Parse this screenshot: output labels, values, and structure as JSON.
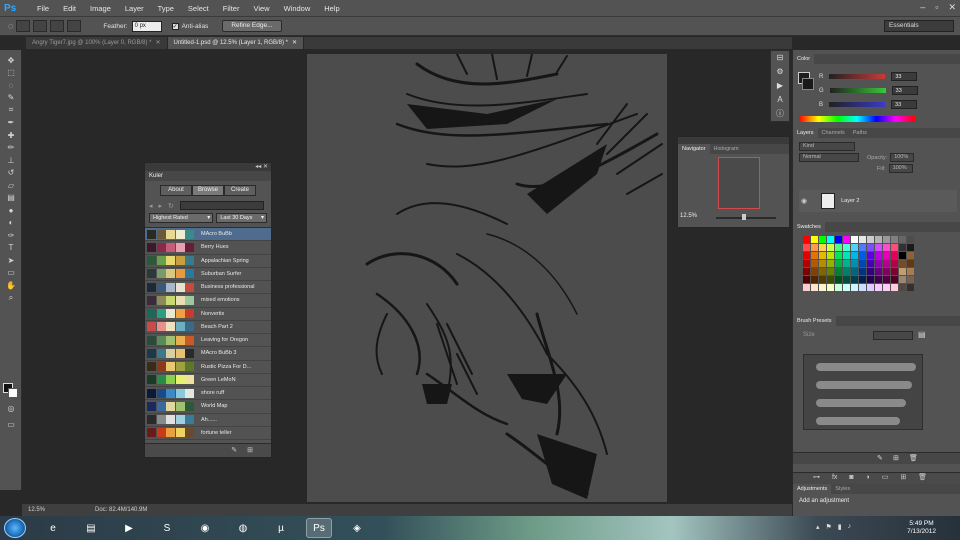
{
  "app": {
    "logo": "Ps"
  },
  "menu": [
    "File",
    "Edit",
    "Image",
    "Layer",
    "Type",
    "Select",
    "Filter",
    "View",
    "Window",
    "Help"
  ],
  "window_controls": [
    "–",
    "▫",
    "✕"
  ],
  "options": {
    "feather_label": "Feather:",
    "feather_value": "0 px",
    "antialias_label": "Anti-alias",
    "antialias_checked": true,
    "refine_edge": "Refine Edge...",
    "workspace": "Essentials"
  },
  "tabs": [
    {
      "label": "Angry Tiger7.jpg @ 100% (Layer 0, RGB/8) *",
      "active": false
    },
    {
      "label": "Untitled-1.psd @ 12.5% (Layer 1, RGB/8) *",
      "active": true
    }
  ],
  "tools": [
    {
      "name": "move-tool-icon",
      "glyph": "✥"
    },
    {
      "name": "marquee-tool-icon",
      "glyph": "⬚"
    },
    {
      "name": "lasso-tool-icon",
      "glyph": "◌"
    },
    {
      "name": "quick-select-icon",
      "glyph": "✎"
    },
    {
      "name": "crop-tool-icon",
      "glyph": "⌗"
    },
    {
      "name": "eyedropper-icon",
      "glyph": "✒"
    },
    {
      "name": "healing-brush-icon",
      "glyph": "✚"
    },
    {
      "name": "brush-tool-icon",
      "glyph": "✏"
    },
    {
      "name": "clone-stamp-icon",
      "glyph": "⊥"
    },
    {
      "name": "history-brush-icon",
      "glyph": "↺"
    },
    {
      "name": "eraser-icon",
      "glyph": "▱"
    },
    {
      "name": "gradient-tool-icon",
      "glyph": "▤"
    },
    {
      "name": "blur-tool-icon",
      "glyph": "●"
    },
    {
      "name": "dodge-tool-icon",
      "glyph": "◐"
    },
    {
      "name": "pen-tool-icon",
      "glyph": "✑"
    },
    {
      "name": "type-tool-icon",
      "glyph": "T"
    },
    {
      "name": "path-select-icon",
      "glyph": "➤"
    },
    {
      "name": "shape-tool-icon",
      "glyph": "▭"
    },
    {
      "name": "hand-tool-icon",
      "glyph": "✋"
    },
    {
      "name": "zoom-tool-icon",
      "glyph": "⌕"
    }
  ],
  "status": {
    "zoom": "12.5%",
    "doc": "Doc: 82.4M/140.9M"
  },
  "kuler": {
    "title": "Kuler",
    "collapse": "◂◂ ✕",
    "buttons": [
      "About",
      "Browse",
      "Create"
    ],
    "filters": [
      "Highest Rated",
      "Last 30 Days"
    ],
    "themes": [
      {
        "name": "MAcro BuBb",
        "colors": [
          "#2a2a22",
          "#6b5a3a",
          "#e8d890",
          "#f0ecd0",
          "#3a8c8c"
        ],
        "selected": true
      },
      {
        "name": "Berry Hues",
        "colors": [
          "#3a1a2a",
          "#8a2a4a",
          "#c85a7a",
          "#e8a0b0",
          "#6a1a3a"
        ]
      },
      {
        "name": "Appalachian Spring",
        "colors": [
          "#2a5a3a",
          "#6aa04a",
          "#e8d870",
          "#c8a040",
          "#3a7a8a"
        ]
      },
      {
        "name": "Suburban Surfer",
        "colors": [
          "#2a3a3a",
          "#7a9a6a",
          "#d8c880",
          "#e89a40",
          "#2a7aa0"
        ]
      },
      {
        "name": "Business professional",
        "colors": [
          "#1a2a3a",
          "#3a5a7a",
          "#a8b8c8",
          "#e8e0d0",
          "#c84a3a"
        ]
      },
      {
        "name": "mixed emotions",
        "colors": [
          "#3a2a3a",
          "#8a8a5a",
          "#c8d870",
          "#e8e0b0",
          "#a0c8a0"
        ]
      },
      {
        "name": "Nonvertis",
        "colors": [
          "#1a6a5a",
          "#2aa080",
          "#e8e8d0",
          "#f0a040",
          "#c83a2a"
        ]
      },
      {
        "name": "Beach Part 2",
        "colors": [
          "#c84a4a",
          "#e89090",
          "#f0e0c0",
          "#6ab0c0",
          "#3a6a8a"
        ]
      },
      {
        "name": "Leaving for Oregon",
        "colors": [
          "#2a4a3a",
          "#5a8a5a",
          "#a0c070",
          "#e8b050",
          "#c85a2a"
        ]
      },
      {
        "name": "MAcro BuBb 3",
        "colors": [
          "#1a3a4a",
          "#3a7a8a",
          "#d8d0a0",
          "#e8c070",
          "#2a2a2a"
        ]
      },
      {
        "name": "Rustic Pizza For D...",
        "colors": [
          "#3a2a1a",
          "#8a3a1a",
          "#e8c870",
          "#a0a040",
          "#5a7a2a"
        ]
      },
      {
        "name": "Green LeMoN",
        "colors": [
          "#1a3a2a",
          "#2a8a4a",
          "#8ad04a",
          "#e8f070",
          "#f0e0a0"
        ]
      },
      {
        "name": "shore ruff",
        "colors": [
          "#0a1a3a",
          "#1a4a8a",
          "#3a8ac8",
          "#8ac8e0",
          "#e0e8e0"
        ]
      },
      {
        "name": "World Map",
        "colors": [
          "#1a2a5a",
          "#3a6aa0",
          "#e0d8a0",
          "#a0c070",
          "#2a5a3a"
        ]
      },
      {
        "name": "Ah......",
        "colors": [
          "#2a2a2a",
          "#8a8a8a",
          "#e0e0e0",
          "#a0d0e0",
          "#3a7a9a"
        ]
      },
      {
        "name": "fortune teller",
        "colors": [
          "#6a1a1a",
          "#c83a1a",
          "#e8a040",
          "#f0d060",
          "#6a4a2a"
        ]
      }
    ]
  },
  "navigator": {
    "tabs": [
      "Navigator",
      "Histogram"
    ],
    "zoom": "12.5%"
  },
  "color": {
    "tab": "Color",
    "channels": [
      {
        "label": "R",
        "value": "33",
        "bar": "#c83a3a"
      },
      {
        "label": "G",
        "value": "33",
        "bar": "#3ac83a"
      },
      {
        "label": "B",
        "value": "33",
        "bar": "#3a3ac8"
      }
    ]
  },
  "layers": {
    "tabs": [
      "Layers",
      "Channels",
      "Paths"
    ],
    "kind": "Kind",
    "blend": "Normal",
    "opacity_label": "Opacity:",
    "opacity": "100%",
    "fill_label": "Fill:",
    "fill": "100%",
    "layer_name": "Layer 2"
  },
  "swatches_title": "Swatches",
  "swatch_colors": [
    "#ff0000",
    "#ffff00",
    "#00ff00",
    "#00ffff",
    "#0000ff",
    "#ff00ff",
    "#ffffff",
    "#e6e6e6",
    "#cccccc",
    "#b3b3b3",
    "#999999",
    "#808080",
    "#666666",
    "#4d4d4d",
    "#ff4d4d",
    "#ff9a4d",
    "#ffd24d",
    "#d2ff4d",
    "#4dff7a",
    "#4dffd2",
    "#4dd2ff",
    "#4d7aff",
    "#7a4dff",
    "#d24dff",
    "#ff4dd2",
    "#ff4d7a",
    "#333333",
    "#1a1a1a",
    "#e60000",
    "#e67300",
    "#e6b800",
    "#b8e600",
    "#00e65c",
    "#00e6b8",
    "#00b8e6",
    "#005ce6",
    "#5c00e6",
    "#b800e6",
    "#e600b8",
    "#e6005c",
    "#000000",
    "#8c6239",
    "#b30000",
    "#b35900",
    "#b38f00",
    "#8fb300",
    "#00b347",
    "#00b38f",
    "#008fb3",
    "#0047b3",
    "#4700b3",
    "#8f00b3",
    "#b3008f",
    "#b30047",
    "#754c24",
    "#603913",
    "#800000",
    "#804000",
    "#806600",
    "#668000",
    "#008033",
    "#008066",
    "#006680",
    "#003380",
    "#330080",
    "#660080",
    "#800066",
    "#800033",
    "#c69c6d",
    "#a67c52",
    "#4d0000",
    "#4d2600",
    "#4d3d00",
    "#3d4d00",
    "#004d1f",
    "#004d3d",
    "#003d4d",
    "#001f4d",
    "#1f004d",
    "#3d004d",
    "#4d003d",
    "#4d001f",
    "#998675",
    "#736357",
    "#ffcccc",
    "#ffe6cc",
    "#fff5cc",
    "#f5ffcc",
    "#ccffdd",
    "#ccfff5",
    "#ccf5ff",
    "#ccddff",
    "#ddccff",
    "#f5ccff",
    "#ffccf5",
    "#ffccdd",
    "#534741",
    "#362f2d"
  ],
  "brush": {
    "tab": "Brush Presets",
    "size_label": "Size"
  },
  "adjustments": {
    "tabs": [
      "Adjustments",
      "Styles"
    ],
    "title": "Add an adjustment"
  },
  "taskbar": {
    "apps": [
      {
        "name": "ie-icon",
        "glyph": "e"
      },
      {
        "name": "explorer-icon",
        "glyph": "▤"
      },
      {
        "name": "media-player-icon",
        "glyph": "▶"
      },
      {
        "name": "skype-icon",
        "glyph": "S"
      },
      {
        "name": "chrome-icon",
        "glyph": "◉"
      },
      {
        "name": "firefox-icon",
        "glyph": "◍"
      },
      {
        "name": "utorrent-icon",
        "glyph": "µ"
      },
      {
        "name": "photoshop-taskbar-icon",
        "glyph": "Ps"
      },
      {
        "name": "app-icon",
        "glyph": "◈"
      }
    ],
    "time": "5:49 PM",
    "date": "7/13/2012"
  }
}
